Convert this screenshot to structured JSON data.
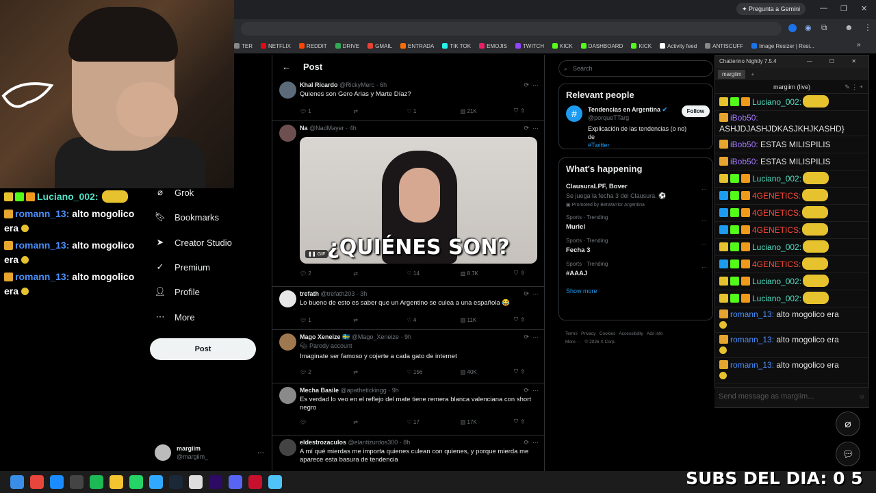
{
  "browser": {
    "gemini_label": "Pregunta a Gemini",
    "bookmarks": [
      {
        "label": "TER",
        "color": "#888888"
      },
      {
        "label": "NETFLIX",
        "color": "#e50914"
      },
      {
        "label": "REDDIT",
        "color": "#ff4500"
      },
      {
        "label": "DRIVE",
        "color": "#34a853"
      },
      {
        "label": "GMAIL",
        "color": "#ea4335"
      },
      {
        "label": "ENTRADA",
        "color": "#ff6d00"
      },
      {
        "label": "TIK TOK",
        "color": "#25f4ee"
      },
      {
        "label": "EMOJIS",
        "color": "#e91e63"
      },
      {
        "label": "TWITCH",
        "color": "#9146ff"
      },
      {
        "label": "KICK",
        "color": "#53fc18"
      },
      {
        "label": "DASHBOARD",
        "color": "#53fc18"
      },
      {
        "label": "KICK",
        "color": "#53fc18"
      },
      {
        "label": "Activity feed",
        "color": "#ffffff"
      },
      {
        "label": "ANTISCUFF",
        "color": "#888888"
      },
      {
        "label": "Image Resizer | Resi...",
        "color": "#1a73e8"
      }
    ]
  },
  "overlay_chat": [
    {
      "user": "Luciano_002:",
      "text": "",
      "style": "teal"
    },
    {
      "user": "romann_13:",
      "text": "alto mogolico era",
      "style": "blue"
    },
    {
      "user": "romann_13:",
      "text": "alto mogolico era",
      "style": "blue"
    },
    {
      "user": "romann_13:",
      "text": "alto mogolico era",
      "style": "blue"
    }
  ],
  "x_nav": [
    {
      "label": "Grok",
      "icon": "grok-icon"
    },
    {
      "label": "Bookmarks",
      "icon": "bookmark-icon"
    },
    {
      "label": "Creator Studio",
      "icon": "creator-studio-icon"
    },
    {
      "label": "Premium",
      "icon": "premium-icon"
    },
    {
      "label": "Profile",
      "icon": "profile-icon"
    },
    {
      "label": "More",
      "icon": "more-icon"
    }
  ],
  "x_post_button": "Post",
  "x_account": {
    "name": "margiim",
    "handle": "@margiim_",
    "menu": "···"
  },
  "timeline": {
    "header": "Post",
    "tweets": [
      {
        "name": "Khal Ricardo",
        "handle": "@RickyMerc",
        "time": "6h",
        "text": "Quienes son Gero Arias y Marte Díaz?",
        "replies": "1",
        "reposts": "",
        "likes": "1",
        "views": "21K",
        "avatar_color": "#5b6b7a"
      },
      {
        "name": "Na",
        "handle": "@NadMayer",
        "time": "4h",
        "text": "",
        "gif_caption": "¿QUIÉNES SON?",
        "gif_tag": "GIF",
        "replies": "2",
        "reposts": "",
        "likes": "14",
        "views": "8.7K",
        "avatar_color": "#6e4f4f"
      },
      {
        "name": "trefath",
        "handle": "@trefath203",
        "time": "3h",
        "text": "Lo bueno de esto es saber que un Argentino se culea a una española 😂",
        "replies": "1",
        "reposts": "",
        "likes": "4",
        "views": "11K",
        "avatar_color": "#e7e7e7"
      },
      {
        "name": "Mago Xeneize 🇸🇪",
        "handle": "@Mago_Xeneize",
        "time": "9h",
        "sub": "Parody account",
        "text": "Imaginate ser famoso y cojerte a cada gato de internet",
        "replies": "2",
        "reposts": "",
        "likes": "156",
        "views": "40K",
        "avatar_color": "#a07850"
      },
      {
        "name": "Mecha Basile",
        "handle": "@apathetickingg",
        "time": "9h",
        "text": "Es verdad lo veo en el reflejo del mate tiene remera blanca valenciana con short negro",
        "replies": "",
        "reposts": "",
        "likes": "17",
        "views": "17K",
        "avatar_color": "#8a8a8a"
      },
      {
        "name": "eldestrozaculos",
        "handle": "@elantizurdos300",
        "time": "8h",
        "text": "A mí qué mierdas me importa quienes culean con quienes, y porque mierda me aparece esta basura de tendencia",
        "replies": "",
        "reposts": "",
        "likes": "",
        "views": "",
        "avatar_color": "#444444"
      }
    ]
  },
  "right_col": {
    "search_placeholder": "Search",
    "relevant_title": "Relevant people",
    "person": {
      "name": "Tendencias en Argentina",
      "handle": "@porqueTTarg",
      "bio": "Explicación de las tendencias (o no) de",
      "bio_link": "#Twitter",
      "follow": "Follow"
    },
    "happening_title": "What's happening",
    "trends": [
      {
        "context": "ClausuraLPF, Bover",
        "sub": "Se juega la fecha 3 del Clausura. ⚽",
        "promo": "Promoted by BetWarrior Argentina",
        "title": ""
      },
      {
        "context": "Sports · Trending",
        "title": "Muriel"
      },
      {
        "context": "Sports · Trending",
        "title": "Fecha 3"
      },
      {
        "context": "Sports · Trending",
        "title": "#AAAJ"
      }
    ],
    "show_more": "Show more",
    "footer": [
      "Terms",
      "Privacy",
      "Cookies",
      "Accessibility",
      "Ads info",
      "More ···",
      "© 2026 X Corp."
    ]
  },
  "chatterino": {
    "title": "Chatterino Nightly 7.5.4",
    "tab": "margiim",
    "split_title": "margiim (live)",
    "input_placeholder": "Send message as margiim...",
    "messages": [
      {
        "user": "Luciano_002:",
        "text": "",
        "style": "lucia",
        "emote": true
      },
      {
        "user": "iBob50:",
        "text": "ASHJDJASHJDKASJKHJKASHD}",
        "style": "ibob",
        "emote": false,
        "wrap": true
      },
      {
        "user": "iBob50:",
        "text": "ESTAS MILISPILIS",
        "style": "ibob",
        "emote": false
      },
      {
        "user": "iBob50:",
        "text": "ESTAS MILISPILIS",
        "style": "ibob",
        "emote": false
      },
      {
        "user": "Luciano_002:",
        "text": "",
        "style": "lucia",
        "emote": true
      },
      {
        "user": "4GENETICS:",
        "text": "",
        "style": "gen",
        "emote": true
      },
      {
        "user": "4GENETICS:",
        "text": "",
        "style": "gen",
        "emote": true
      },
      {
        "user": "4GENETICS:",
        "text": "",
        "style": "gen",
        "emote": true
      },
      {
        "user": "Luciano_002:",
        "text": "",
        "style": "lucia",
        "emote": true
      },
      {
        "user": "4GENETICS:",
        "text": "",
        "style": "gen",
        "emote": true
      },
      {
        "user": "Luciano_002:",
        "text": "",
        "style": "lucia",
        "emote": true
      },
      {
        "user": "Luciano_002:",
        "text": "",
        "style": "lucia",
        "emote": true
      },
      {
        "user": "romann_13:",
        "text": "alto mogolico era",
        "style": "rom",
        "emote": false,
        "wrap": true
      },
      {
        "user": "romann_13:",
        "text": "alto mogolico era",
        "style": "rom",
        "emote": false,
        "wrap": true
      },
      {
        "user": "romann_13:",
        "text": "alto mogolico era",
        "style": "rom",
        "emote": false,
        "wrap": true
      }
    ]
  },
  "subs_overlay": "SUBS DEL DIA: 0 5",
  "taskbar_icons": [
    "windows-start",
    "chrome",
    "edge",
    "obs",
    "spotify",
    "file-explorer",
    "whatsapp",
    "photoshop",
    "steam",
    "chatgpt",
    "premiere",
    "discord",
    "ccleaner",
    "notepad"
  ]
}
